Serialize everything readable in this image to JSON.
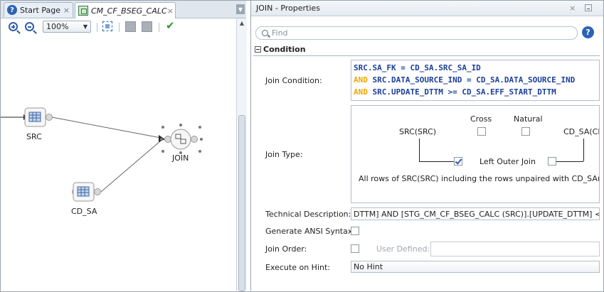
{
  "editor": {
    "tabs": [
      {
        "label": "Start Page",
        "icon": "help-icon"
      },
      {
        "label": "CM_CF_BSEG_CALC",
        "icon": "mapping-icon"
      }
    ],
    "tab_close": "×",
    "toolbar": {
      "zoom_value": "100%"
    },
    "diagram": {
      "nodes": [
        {
          "label": "SRC"
        },
        {
          "label": "CD_SA"
        },
        {
          "label": "JOIN"
        }
      ]
    }
  },
  "properties": {
    "title": "JOIN - Properties",
    "close_glyph": "×",
    "find_placeholder": "Find",
    "help_glyph": "?",
    "section_title": "Condition",
    "join_condition": {
      "label": "Join Condition:",
      "lines": [
        {
          "keyword": "",
          "text": "SRC.SA_FK = CD_SA.SRC_SA_ID"
        },
        {
          "keyword": "AND",
          "text": " SRC.DATA_SOURCE_IND = CD_SA.DATA_SOURCE_IND"
        },
        {
          "keyword": "AND",
          "text": " SRC.UPDATE_DTTM >= CD_SA.EFF_START_DTTM"
        }
      ]
    },
    "join_type": {
      "label": "Join Type:",
      "left_source": "SRC(SRC)",
      "right_source": "CD_SA(CD",
      "cross_label": "Cross",
      "natural_label": "Natural",
      "left_outer_label": "Left Outer Join",
      "description": "All rows of SRC(SRC) including the rows unpaired with CD_SA(CD_SA)",
      "cross_checked": false,
      "natural_checked": false,
      "left_outer_checked": true,
      "right_outer_checked": false
    },
    "technical_description": {
      "label": "Technical Description:",
      "value": "DTTM]  AND [STG_CM_CF_BSEG_CALC (SRC)].[UPDATE_DTTM] < [CD_"
    },
    "generate_ansi": {
      "label": "Generate ANSI Syntax:",
      "checked": false
    },
    "join_order": {
      "label": "Join Order:",
      "checked": false,
      "user_defined_label": "User Defined:",
      "user_defined_value": ""
    },
    "execute_on_hint": {
      "label": "Execute on Hint:",
      "value": "No Hint"
    }
  },
  "colors": {
    "keyword": "#f0a800",
    "sql_text": "#1b3f9a",
    "accent_blue": "#2b63b6",
    "validate_green": "#2d9a2d"
  }
}
